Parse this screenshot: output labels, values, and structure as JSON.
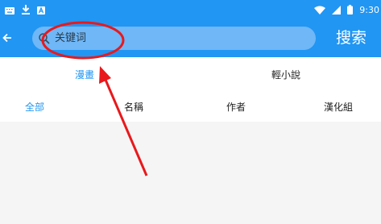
{
  "status_bar": {
    "left_icons": [
      "keyboard-icon",
      "download-icon",
      "notification-a-icon"
    ],
    "right_icons": [
      "wifi-icon",
      "signal-icon",
      "battery-icon"
    ],
    "time": "9:30"
  },
  "app_bar": {
    "back_icon": "arrow-left-icon",
    "search": {
      "placeholder": "关键词",
      "value": ""
    },
    "search_action_label": "搜索"
  },
  "tabs": [
    {
      "label": "漫畫",
      "active": true
    },
    {
      "label": "輕小說",
      "active": false
    }
  ],
  "filters": [
    {
      "label": "全部",
      "active": true
    },
    {
      "label": "名稱",
      "active": false
    },
    {
      "label": "作者",
      "active": false
    },
    {
      "label": "漢化組",
      "active": false
    }
  ],
  "annotation": {
    "color": "#e8191c",
    "shapes": [
      "ellipse-highlight",
      "arrow"
    ]
  },
  "colors": {
    "primary": "#2196f3",
    "search_box": "#6fb7f7",
    "active_text": "#2196f3"
  }
}
